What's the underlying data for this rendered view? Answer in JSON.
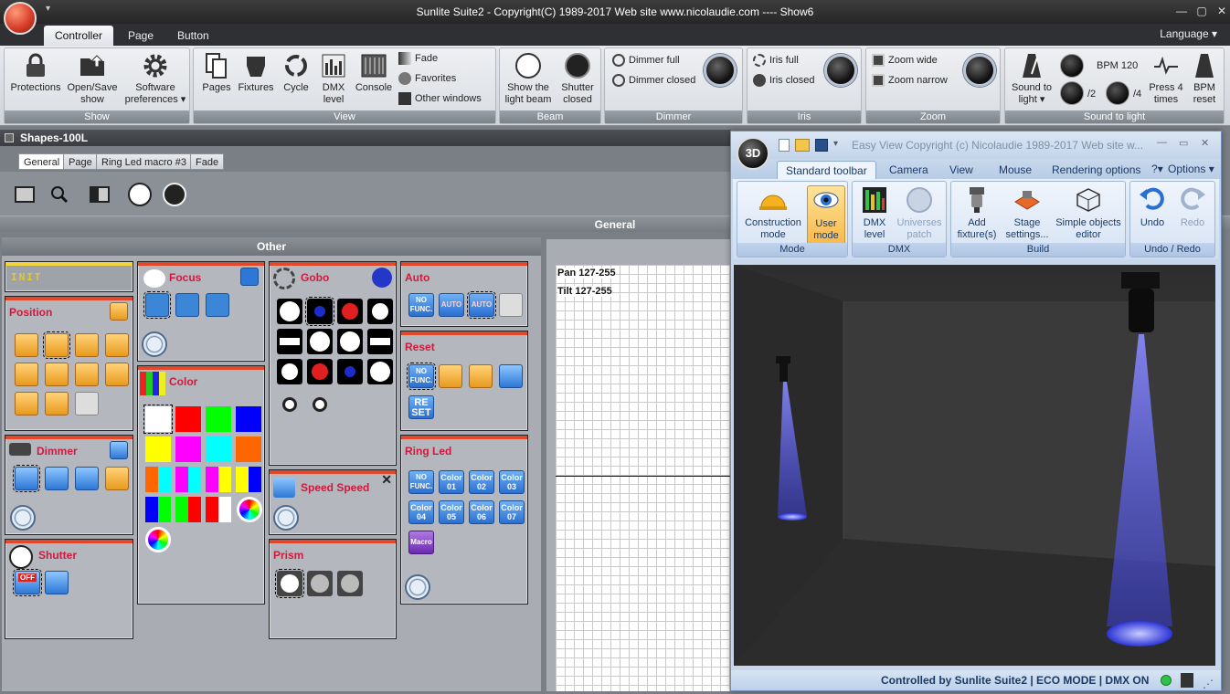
{
  "window": {
    "title": "Sunlite Suite2 - Copyright(C) 1989-2017    Web site www.nicolaudie.com ---- Show6",
    "quick_access": "▾"
  },
  "ribbon_tabs": [
    "Controller",
    "Page",
    "Button"
  ],
  "language": "Language",
  "groups": {
    "show": {
      "title": "Show",
      "protections": "Protections",
      "open_save": "Open/Save show",
      "software": "Software preferences"
    },
    "view": {
      "title": "View",
      "pages": "Pages",
      "fixtures": "Fixtures",
      "cycle": "Cycle",
      "dmx": "DMX level",
      "console": "Console",
      "fade": "Fade",
      "favorites": "Favorites",
      "other_windows": "Other windows"
    },
    "beam": {
      "title": "Beam",
      "show_beam": "Show the light beam",
      "shutter_closed": "Shutter closed"
    },
    "dimmer": {
      "title": "Dimmer",
      "full": "Dimmer full",
      "closed": "Dimmer closed"
    },
    "iris": {
      "title": "Iris",
      "full": "Iris full",
      "closed": "Iris closed"
    },
    "zoom": {
      "title": "Zoom",
      "wide": "Zoom wide",
      "narrow": "Zoom narrow"
    },
    "sound": {
      "title": "Sound to light",
      "sound_to_light": "Sound to light",
      "bpm": "BPM 120",
      "div2": "/2",
      "div4": "/4",
      "press4": "Press 4 times",
      "bpm_reset": "BPM reset"
    }
  },
  "page_title": "Shapes-100L",
  "page_tabs": [
    "General",
    "Page",
    "Ring Led macro #3",
    "Fade"
  ],
  "general_header": "General",
  "other_header": "Other",
  "panels": {
    "init": "INIT",
    "position": "Position",
    "focus": "Focus",
    "gobo": "Gobo",
    "auto": "Auto",
    "reset": "Reset",
    "color": "Color",
    "dimmer": "Dimmer",
    "speed": "Speed Speed",
    "ring_led": "Ring Led",
    "shutter": "Shutter",
    "prism": "Prism"
  },
  "chips": {
    "no_func": "NO FUNC.",
    "auto": "AUTO",
    "reset": "RE SET",
    "off": "OFF",
    "macro": "Macro",
    "colors": [
      "Color 01",
      "Color 02",
      "Color 03",
      "Color 04",
      "Color 05",
      "Color 06",
      "Color 07"
    ]
  },
  "colors": {
    "swatches_row1": [
      "#ffffff",
      "#ff0000",
      "#00ff00",
      "#0000ff"
    ],
    "swatches_row2": [
      "#ffff00",
      "#ff00ff",
      "#00ffff",
      "#ff6600"
    ],
    "accent_red": "#d0193c",
    "panel_bar": "#e2492c"
  },
  "grid": {
    "pan": "Pan 127-255",
    "tilt": "Tilt 127-255"
  },
  "easyview": {
    "title": "Easy View   Copyright (c) Nicolaudie 1989-2017   Web site w...",
    "logo": "3D",
    "tabs": [
      "Standard toolbar",
      "Camera",
      "View",
      "Mouse",
      "Rendering options"
    ],
    "help": "?",
    "options": "Options",
    "mode_title": "Mode",
    "construction": "Construction mode",
    "user": "User mode",
    "dmx_title": "DMX",
    "dmx_level": "DMX level",
    "universes": "Universes patch",
    "build_title": "Build",
    "add_fixture": "Add fixture(s)",
    "stage": "Stage settings...",
    "simple_objects": "Simple objects editor",
    "undo_title": "Undo / Redo",
    "undo": "Undo",
    "redo": "Redo",
    "status": "Controlled by Sunlite Suite2  |  ECO MODE  |  DMX ON"
  }
}
